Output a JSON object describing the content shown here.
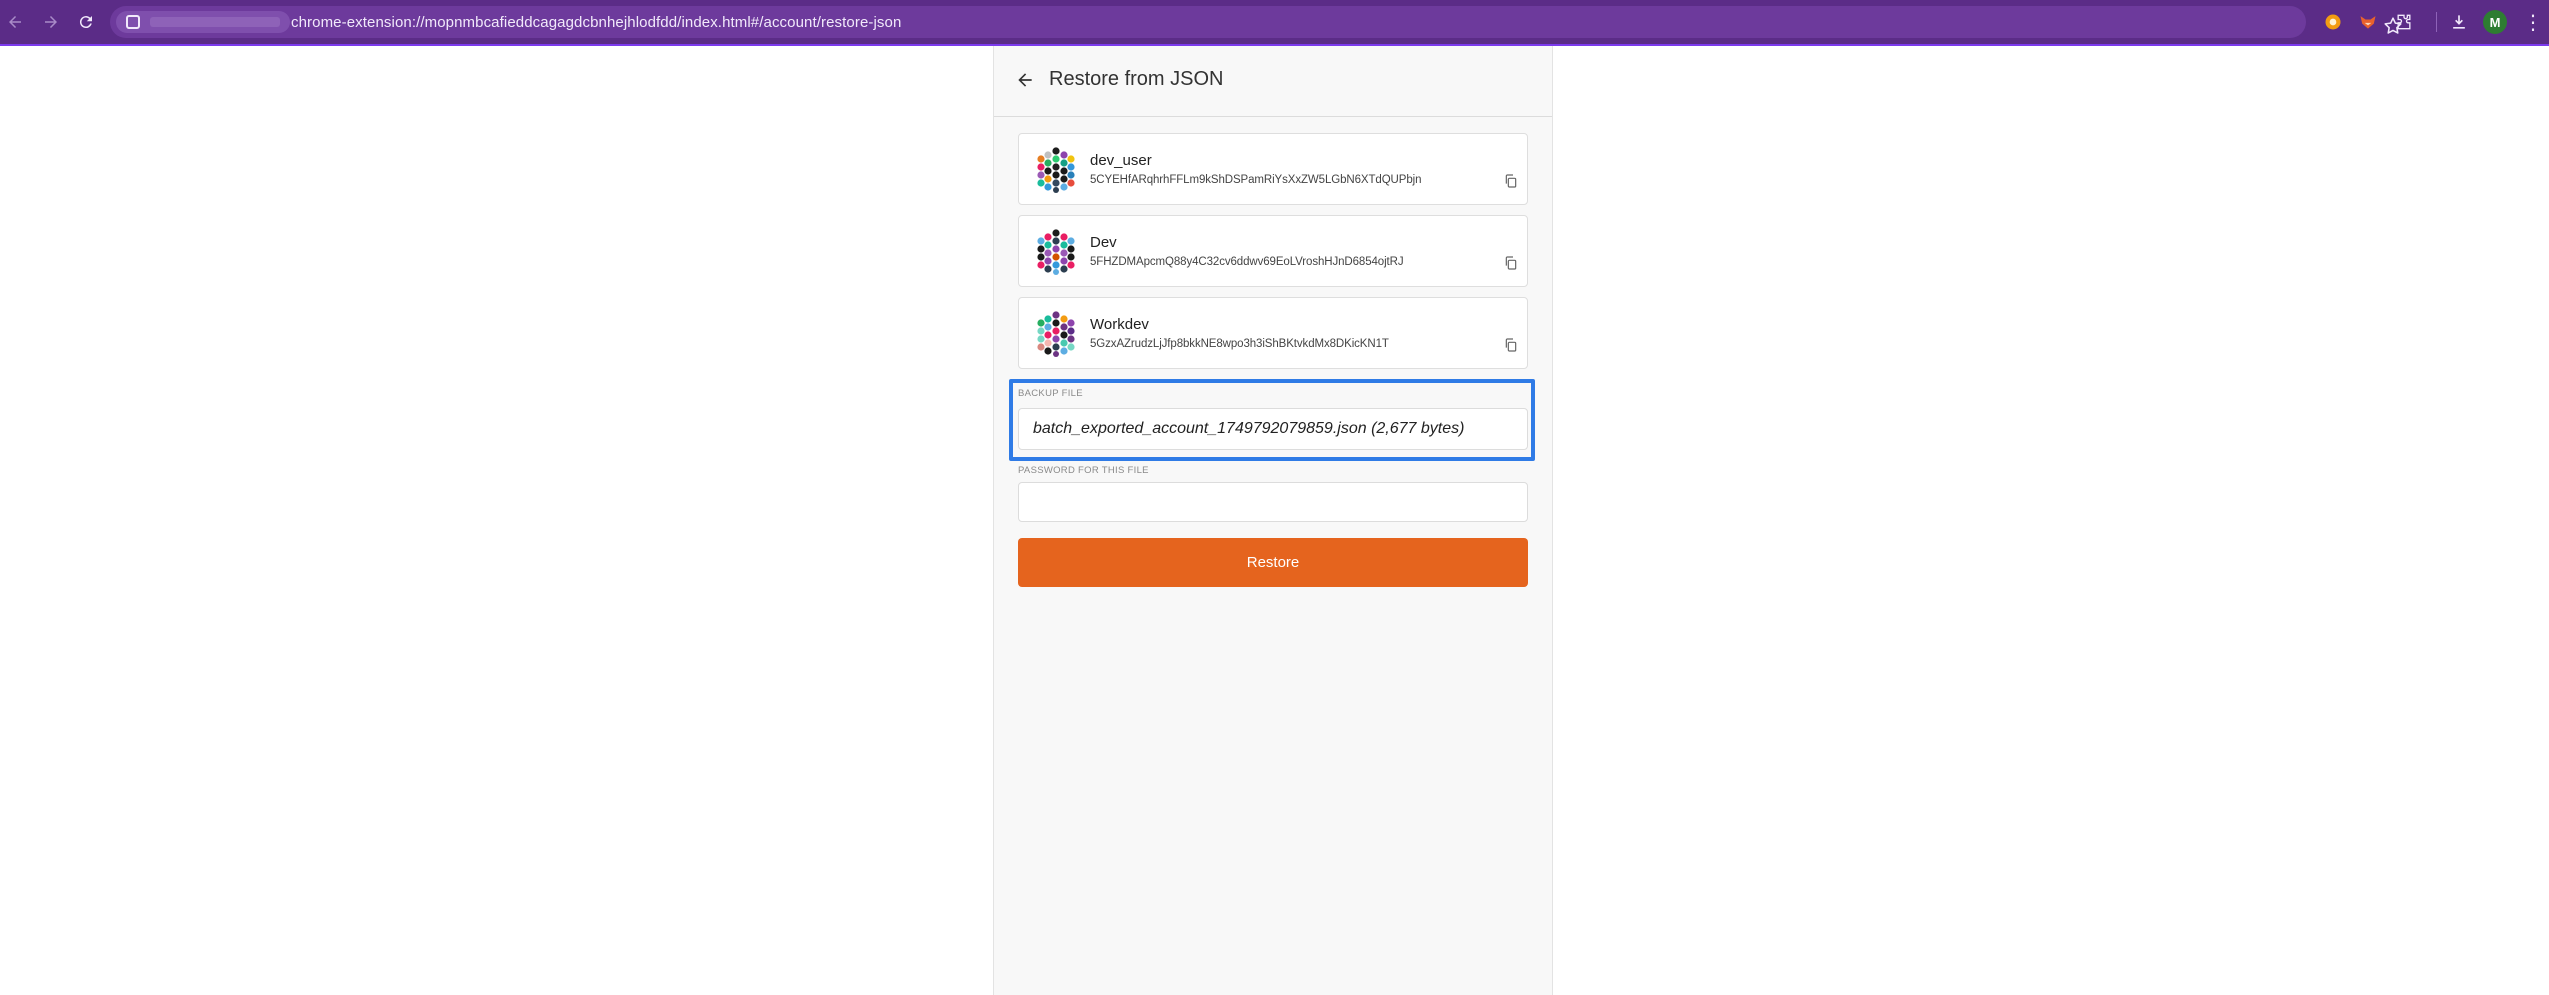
{
  "browser": {
    "url": "chrome-extension://mopnmbcafieddcagagdcbnhejhlodfdd/index.html#/account/restore-json",
    "profile_initial": "M"
  },
  "page": {
    "title": "Restore from JSON"
  },
  "accounts": [
    {
      "name": "dev_user",
      "address": "5CYEHfARqhrhFFLm9kShDSPamRiYsXxZW5LGbN6XTdQUPbjn"
    },
    {
      "name": "Dev",
      "address": "5FHZDMApcmQ88y4C32cv6ddwv69EoLVroshHJnD6854ojtRJ"
    },
    {
      "name": "Workdev",
      "address": "5GzxAZrudzLjJfp8bkkNE8wpo3h3iShBKtvkdMx8DKicKN1T"
    }
  ],
  "backup": {
    "label": "BACKUP FILE",
    "file": "batch_exported_account_1749792079859.json (2,677 bytes)"
  },
  "password": {
    "label": "PASSWORD FOR THIS FILE",
    "value": ""
  },
  "restore_button": "Restore",
  "colors": {
    "chrome": "#5b2c87",
    "accent": "#e5641e",
    "highlight": "#2f7be6"
  }
}
